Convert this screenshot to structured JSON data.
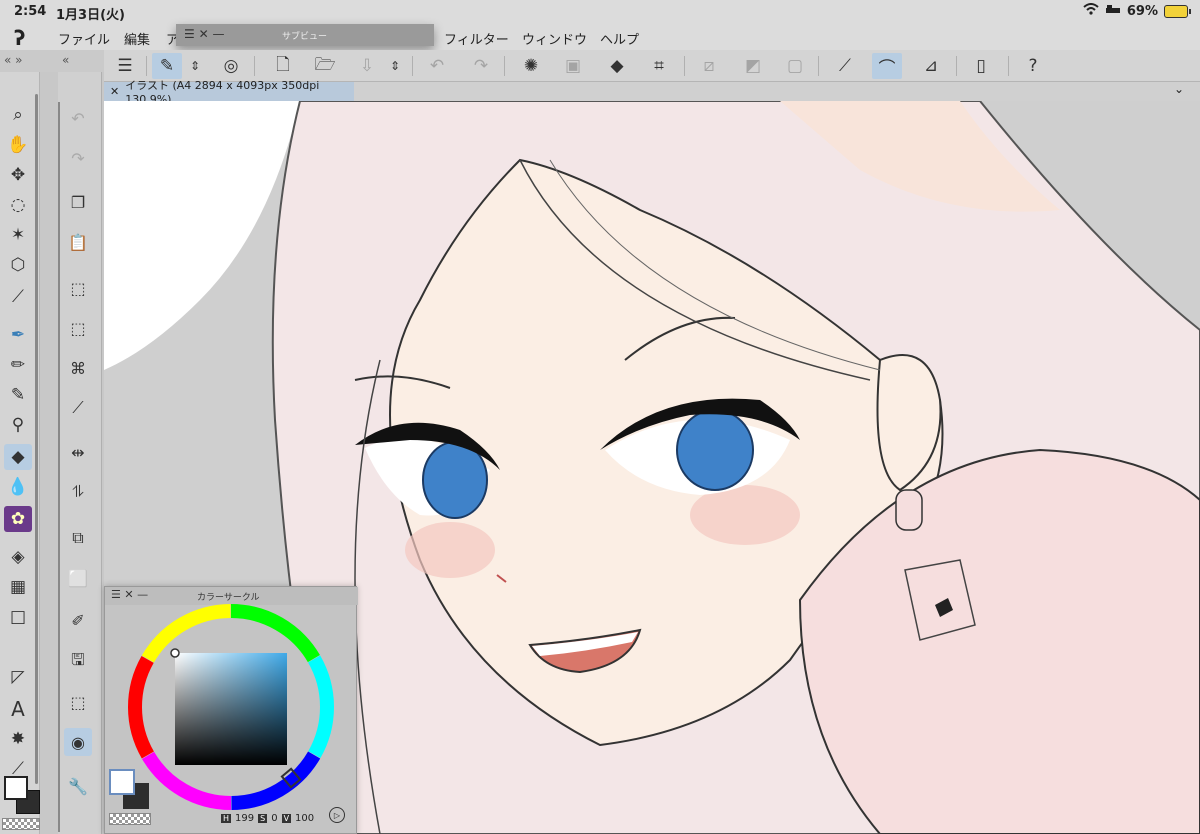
{
  "status_bar": {
    "time": "2:54",
    "date": "1月3日(火)",
    "battery": "69%"
  },
  "menu": {
    "logo": "ʔ",
    "items": [
      "ファイル",
      "編集",
      "ア",
      "フィルター",
      "ウィンドウ",
      "ヘルプ"
    ]
  },
  "subview": {
    "title": "サブビュー",
    "controls": "☰ ✕ —"
  },
  "document_tab": {
    "title": "イラスト (A4 2894 x 4093px 350dpi 130.9%)",
    "close": "✕",
    "chevron": "⌄"
  },
  "panels": {
    "tool_header": "«  »",
    "subtool_header": "«",
    "color_circle": {
      "title": "カラーサークル",
      "controls": "☰ ✕ —"
    }
  },
  "color_values": {
    "h_label": "H",
    "h": "199",
    "s_label": "S",
    "s": "0",
    "v_label": "V",
    "v": "100"
  },
  "colors": {
    "accent_active": "#b7cde2",
    "main_color": "#ffffff",
    "sub_color": "#2d2d2d",
    "eye_blue": "#3f82c9",
    "skin": "#fbeee4",
    "hair": "#f3e6e7"
  },
  "icons": {
    "toolbar": [
      "menu-icon",
      "subtool-eyedropper-icon",
      "chevron-updown-icon",
      "spiral-icon",
      "new-canvas-icon",
      "open-folder-icon",
      "save-icon",
      "chevron-updown-icon",
      "undo-icon",
      "redo-icon",
      "loading-icon",
      "transform-icon",
      "fill-icon",
      "crop-icon",
      "deselect-icon",
      "invert-selection-icon",
      "select-all-icon",
      "pen-snap-icon",
      "brush-active-icon",
      "ruler-icon",
      "device-icon",
      "help-icon"
    ],
    "tools": [
      "zoom-icon",
      "hand-icon",
      "move-icon",
      "lasso-icon",
      "magic-wand-icon",
      "cube-icon",
      "eyedropper-icon",
      "pen-icon",
      "pencil-icon",
      "brush-icon",
      "airbrush-icon",
      "eraser-icon",
      "blend-icon",
      "decoration-icon",
      "fill-icon",
      "gradient-icon",
      "shape-icon",
      "ruler-icon",
      "text-icon",
      "burst-icon",
      "correction-icon"
    ]
  }
}
